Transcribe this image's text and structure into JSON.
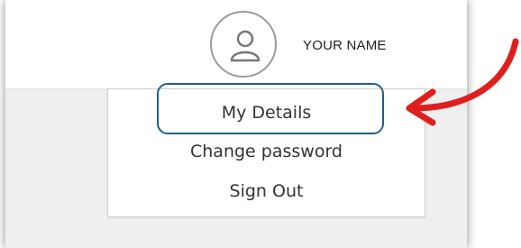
{
  "header": {
    "user_name": "YOUR NAME"
  },
  "menu": {
    "items": [
      {
        "label": "My Details"
      },
      {
        "label": "Change password"
      },
      {
        "label": "Sign Out"
      }
    ]
  },
  "colors": {
    "highlight": "#1e5f8e",
    "arrow": "#e01e1e"
  },
  "icons": {
    "avatar": "user-icon"
  }
}
